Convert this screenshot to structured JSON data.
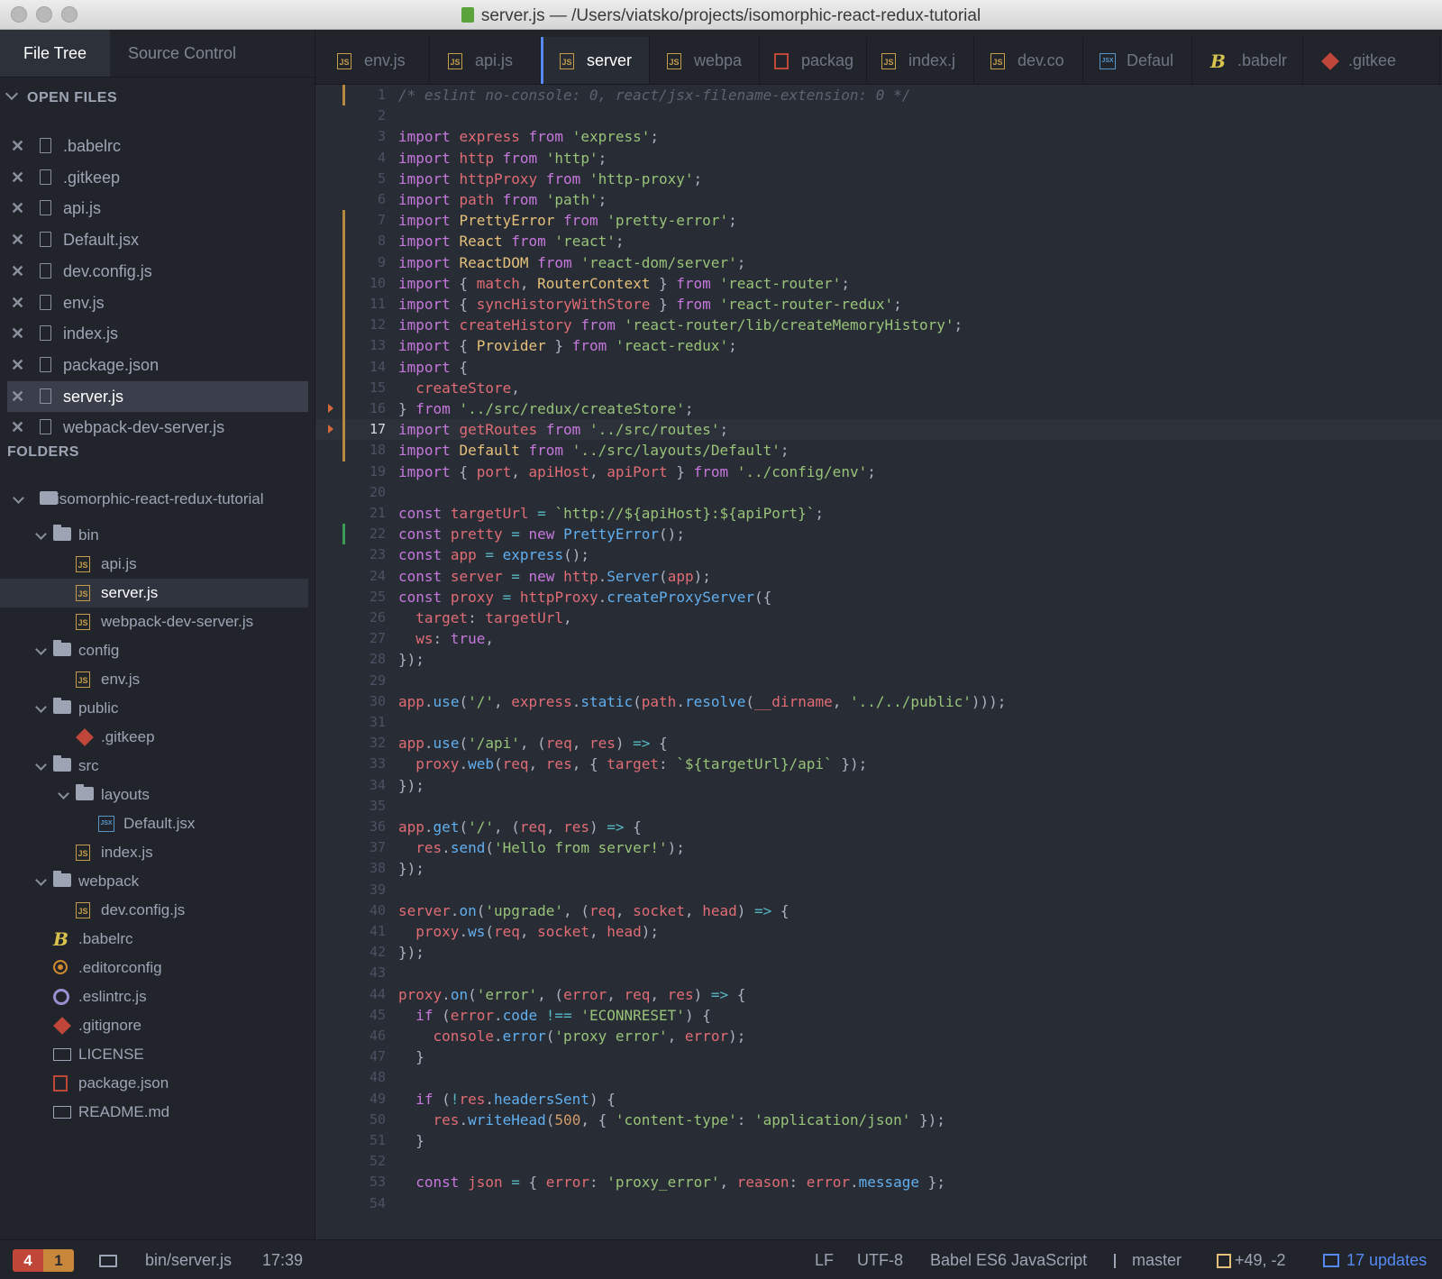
{
  "window": {
    "title": "server.js — /Users/viatsko/projects/isomorphic-react-redux-tutorial"
  },
  "sidebar": {
    "tabs": [
      {
        "label": "File Tree"
      },
      {
        "label": "Source Control"
      }
    ],
    "open_files_heading": "OPEN FILES",
    "open_files": [
      {
        "name": ".babelrc"
      },
      {
        "name": ".gitkeep"
      },
      {
        "name": "api.js"
      },
      {
        "name": "Default.jsx"
      },
      {
        "name": "dev.config.js"
      },
      {
        "name": "env.js"
      },
      {
        "name": "index.js"
      },
      {
        "name": "package.json"
      },
      {
        "name": "server.js"
      },
      {
        "name": "webpack-dev-server.js"
      }
    ],
    "folders_heading": "FOLDERS",
    "tree": [
      {
        "name": "isomorphic-react-redux-tutorial",
        "icon": "repo-icon"
      },
      {
        "name": "bin",
        "icon": "folder-icon"
      },
      {
        "name": "api.js",
        "icon": "js-file-icon"
      },
      {
        "name": "server.js",
        "icon": "js-file-icon"
      },
      {
        "name": "webpack-dev-server.js",
        "icon": "js-file-icon"
      },
      {
        "name": "config",
        "icon": "folder-icon"
      },
      {
        "name": "env.js",
        "icon": "js-file-icon"
      },
      {
        "name": "public",
        "icon": "folder-icon"
      },
      {
        "name": ".gitkeep",
        "icon": "git-icon"
      },
      {
        "name": "src",
        "icon": "folder-icon"
      },
      {
        "name": "layouts",
        "icon": "folder-icon"
      },
      {
        "name": "Default.jsx",
        "icon": "jsx-file-icon"
      },
      {
        "name": "index.js",
        "icon": "js-file-icon"
      },
      {
        "name": "webpack",
        "icon": "folder-icon"
      },
      {
        "name": "dev.config.js",
        "icon": "js-file-icon"
      },
      {
        "name": ".babelrc",
        "icon": "babel-icon"
      },
      {
        "name": ".editorconfig",
        "icon": "gear-icon"
      },
      {
        "name": ".eslintrc.js",
        "icon": "eslint-icon"
      },
      {
        "name": ".gitignore",
        "icon": "git-icon"
      },
      {
        "name": "LICENSE",
        "icon": "book-icon"
      },
      {
        "name": "package.json",
        "icon": "npm-icon"
      },
      {
        "name": "README.md",
        "icon": "book-icon"
      }
    ]
  },
  "tabs": [
    {
      "label": "env.js",
      "icon": "js-file-icon"
    },
    {
      "label": "api.js",
      "icon": "js-file-icon"
    },
    {
      "label": "server",
      "icon": "js-file-icon"
    },
    {
      "label": "webpa",
      "icon": "js-file-icon"
    },
    {
      "label": "packag",
      "icon": "npm-icon"
    },
    {
      "label": "index.j",
      "icon": "js-file-icon"
    },
    {
      "label": "dev.co",
      "icon": "js-file-icon"
    },
    {
      "label": "Defaul",
      "icon": "jsx-file-icon"
    },
    {
      "label": ".babelr",
      "icon": "babel-icon"
    },
    {
      "label": ".gitkee",
      "icon": "git-icon"
    }
  ],
  "editor": {
    "current_line": 17,
    "lines": [
      "/* eslint no-console: 0, react/jsx-filename-extension: 0 */",
      "",
      "import express from 'express';",
      "import http from 'http';",
      "import httpProxy from 'http-proxy';",
      "import path from 'path';",
      "import PrettyError from 'pretty-error';",
      "import React from 'react';",
      "import ReactDOM from 'react-dom/server';",
      "import { match, RouterContext } from 'react-router';",
      "import { syncHistoryWithStore } from 'react-router-redux';",
      "import createHistory from 'react-router/lib/createMemoryHistory';",
      "import { Provider } from 'react-redux';",
      "import {",
      "  createStore,",
      "} from '../src/redux/createStore';",
      "import getRoutes from '../src/routes';",
      "import Default from '../src/layouts/Default';",
      "import { port, apiHost, apiPort } from '../config/env';",
      "",
      "const targetUrl = `http://${apiHost}:${apiPort}`;",
      "const pretty = new PrettyError();",
      "const app = express();",
      "const server = new http.Server(app);",
      "const proxy = httpProxy.createProxyServer({",
      "  target: targetUrl,",
      "  ws: true,",
      "});",
      "",
      "app.use('/', express.static(path.resolve(__dirname, '../../public')));",
      "",
      "app.use('/api', (req, res) => {",
      "  proxy.web(req, res, { target: `${targetUrl}/api` });",
      "});",
      "",
      "app.get('/', (req, res) => {",
      "  res.send('Hello from server!');",
      "});",
      "",
      "server.on('upgrade', (req, socket, head) => {",
      "  proxy.ws(req, socket, head);",
      "});",
      "",
      "proxy.on('error', (error, req, res) => {",
      "  if (error.code !== 'ECONNRESET') {",
      "    console.error('proxy error', error);",
      "  }",
      "",
      "  if (!res.headersSent) {",
      "    res.writeHead(500, { 'content-type': 'application/json' });",
      "  }",
      "",
      "  const json = { error: 'proxy_error', reason: error.message };",
      ""
    ]
  },
  "statusbar": {
    "errors": "4",
    "warnings": "1",
    "file_path": "bin/server.js",
    "cursor": "17:39",
    "line_ending": "LF",
    "encoding": "UTF-8",
    "grammar": "Babel ES6 JavaScript",
    "branch": "master",
    "diff": "+49, -2",
    "updates": "17 updates"
  },
  "colors": {
    "keyword": "#c678dd",
    "string": "#98c379",
    "variable": "#e06c75",
    "function": "#61afef",
    "comment": "#5c6370",
    "number": "#d19a66",
    "operator": "#56b6c2",
    "accent": "#568af2",
    "error_badge": "#c0463a",
    "warning_badge": "#c8873a"
  }
}
